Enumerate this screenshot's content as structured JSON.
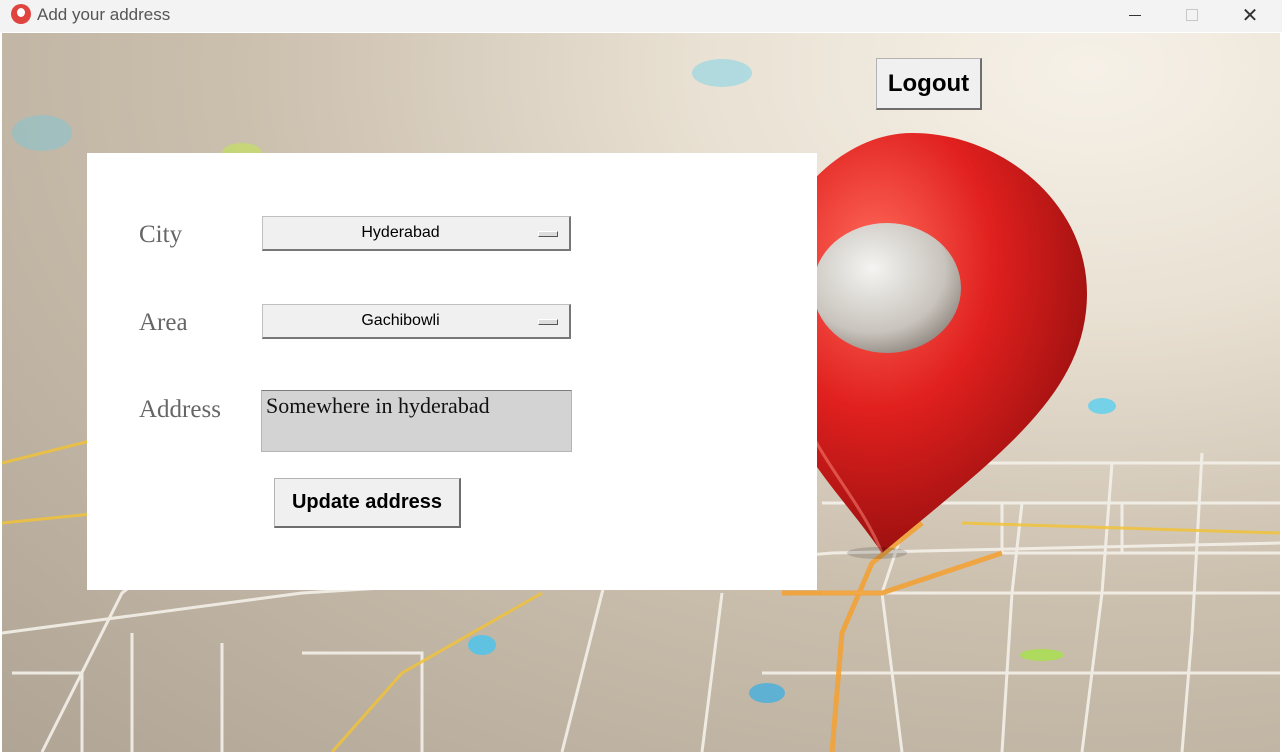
{
  "window": {
    "title": "Add your address",
    "controls": {
      "minimize": "minimize-icon",
      "maximize": "maximize-icon",
      "close": "close-icon"
    },
    "close_glyph": "✕"
  },
  "header": {
    "logout_label": "Logout"
  },
  "form": {
    "city_label": "City",
    "city_value": "Hyderabad",
    "area_label": "Area",
    "area_value": "Gachibowli",
    "address_label": "Address",
    "address_value": "Somewhere in hyderabad",
    "update_label": "Update address"
  },
  "colors": {
    "pin": "#e0201e",
    "panel": "#ffffff",
    "accent_roads": "#f2a236"
  }
}
